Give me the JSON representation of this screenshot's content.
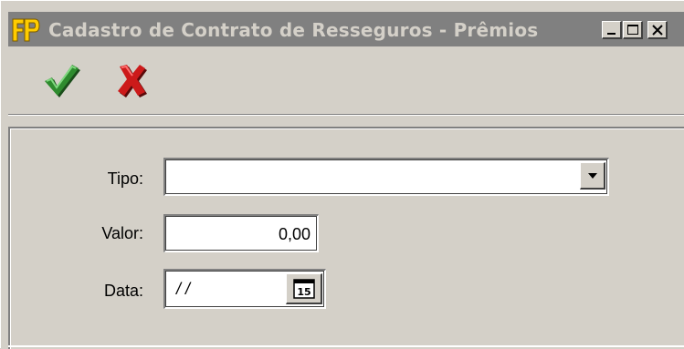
{
  "window": {
    "title": "Cadastro de Contrato de Resseguros - Prêmios",
    "app_icon_text": "FP",
    "minimize_icon": "minimize-icon",
    "maximize_icon": "maximize-icon",
    "close_icon": "close-icon"
  },
  "toolbar": {
    "confirm_icon": "checkmark-icon",
    "cancel_icon": "x-icon",
    "confirm_color": "#2e8b2e",
    "cancel_color": "#cc1a1a"
  },
  "form": {
    "tipo_label": "Tipo:",
    "tipo_value": "",
    "valor_label": "Valor:",
    "valor_value": "0,00",
    "data_label": "Data:",
    "data_value": "/ /",
    "calendar_icon_text": "15"
  }
}
